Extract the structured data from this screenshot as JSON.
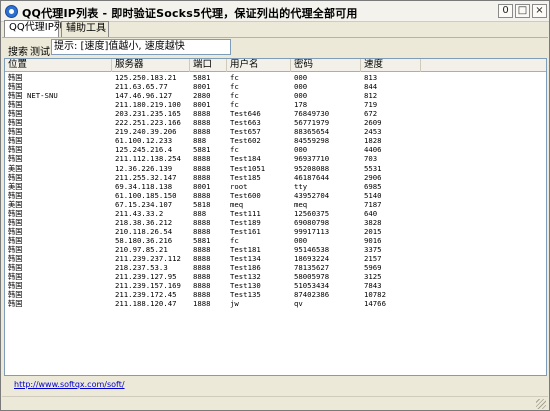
{
  "window": {
    "title": "QQ代理IP列表 - 即时验证Socks5代理，保证列出的代理全部可用",
    "controls": {
      "minimize": "0",
      "maximize": "□",
      "close": "×"
    }
  },
  "tabs": [
    {
      "label": "QQ代理IP列表",
      "active": true
    },
    {
      "label": "辅助工具",
      "active": false
    }
  ],
  "toolbar": {
    "sort_label": "搜索",
    "test_label": "测试",
    "hint": "提示: [速度]值越小, 速度越快"
  },
  "table": {
    "headers": [
      "位置",
      "服务器",
      "端口",
      "用户名",
      "密码",
      "速度"
    ],
    "rows": [
      [
        "韩国",
        "125.250.183.21",
        "5881",
        "fc",
        "000",
        "813"
      ],
      [
        "韩国",
        "211.63.65.77",
        "8001",
        "fc",
        "000",
        "844"
      ],
      [
        "韩国 NET-SNU",
        "147.46.96.127",
        "2880",
        "fc",
        "000",
        "812"
      ],
      [
        "韩国",
        "211.180.219.100",
        "8001",
        "fc",
        "178",
        "719"
      ],
      [
        "韩国",
        "203.231.235.165",
        "8888",
        "Test646",
        "76849730",
        "672"
      ],
      [
        "韩国",
        "222.251.223.166",
        "8888",
        "Test663",
        "56771979",
        "2609"
      ],
      [
        "韩国",
        "219.240.39.206",
        "8888",
        "Test657",
        "88365654",
        "2453"
      ],
      [
        "韩国",
        "61.100.12.233",
        "888",
        "Test602",
        "84559298",
        "1828"
      ],
      [
        "韩国",
        "125.245.216.4",
        "5881",
        "fc",
        "000",
        "4406"
      ],
      [
        "韩国",
        "211.112.138.254",
        "8888",
        "Test184",
        "96937710",
        "703"
      ],
      [
        "美国",
        "12.36.226.139",
        "8888",
        "Test1051",
        "95208088",
        "5531"
      ],
      [
        "韩国",
        "211.255.32.147",
        "8888",
        "Test185",
        "46187644",
        "2906"
      ],
      [
        "美国",
        "69.34.118.138",
        "8001",
        "root",
        "tty",
        "6985"
      ],
      [
        "韩国",
        "61.100.185.150",
        "8888",
        "Test600",
        "43952704",
        "5140"
      ],
      [
        "美国",
        "67.15.234.107",
        "5818",
        "meq",
        "meq",
        "7187"
      ],
      [
        "韩国",
        "211.43.33.2",
        "888",
        "Test111",
        "12560375",
        "640"
      ],
      [
        "韩国",
        "218.38.36.212",
        "8888",
        "Test189",
        "69080798",
        "3828"
      ],
      [
        "韩国",
        "210.118.26.54",
        "8888",
        "Test161",
        "99917113",
        "2015"
      ],
      [
        "韩国",
        "58.180.36.216",
        "5881",
        "fc",
        "000",
        "9016"
      ],
      [
        "韩国",
        "210.97.85.21",
        "8888",
        "Test181",
        "95146538",
        "3375"
      ],
      [
        "韩国",
        "211.239.237.112",
        "8888",
        "Test134",
        "18693224",
        "2157"
      ],
      [
        "韩国",
        "218.237.53.3",
        "8888",
        "Test186",
        "78135627",
        "5969"
      ],
      [
        "韩国",
        "211.239.127.95",
        "8888",
        "Test132",
        "58005978",
        "3125"
      ],
      [
        "韩国",
        "211.239.157.169",
        "8888",
        "Test130",
        "51053434",
        "7843"
      ],
      [
        "韩国",
        "211.239.172.45",
        "8888",
        "Test135",
        "87402386",
        "10782"
      ],
      [
        "韩国",
        "211.188.120.47",
        "1888",
        "jw",
        "qv",
        "14766"
      ]
    ]
  },
  "footer": {
    "link": "http://www.softqx.com/soft/"
  }
}
